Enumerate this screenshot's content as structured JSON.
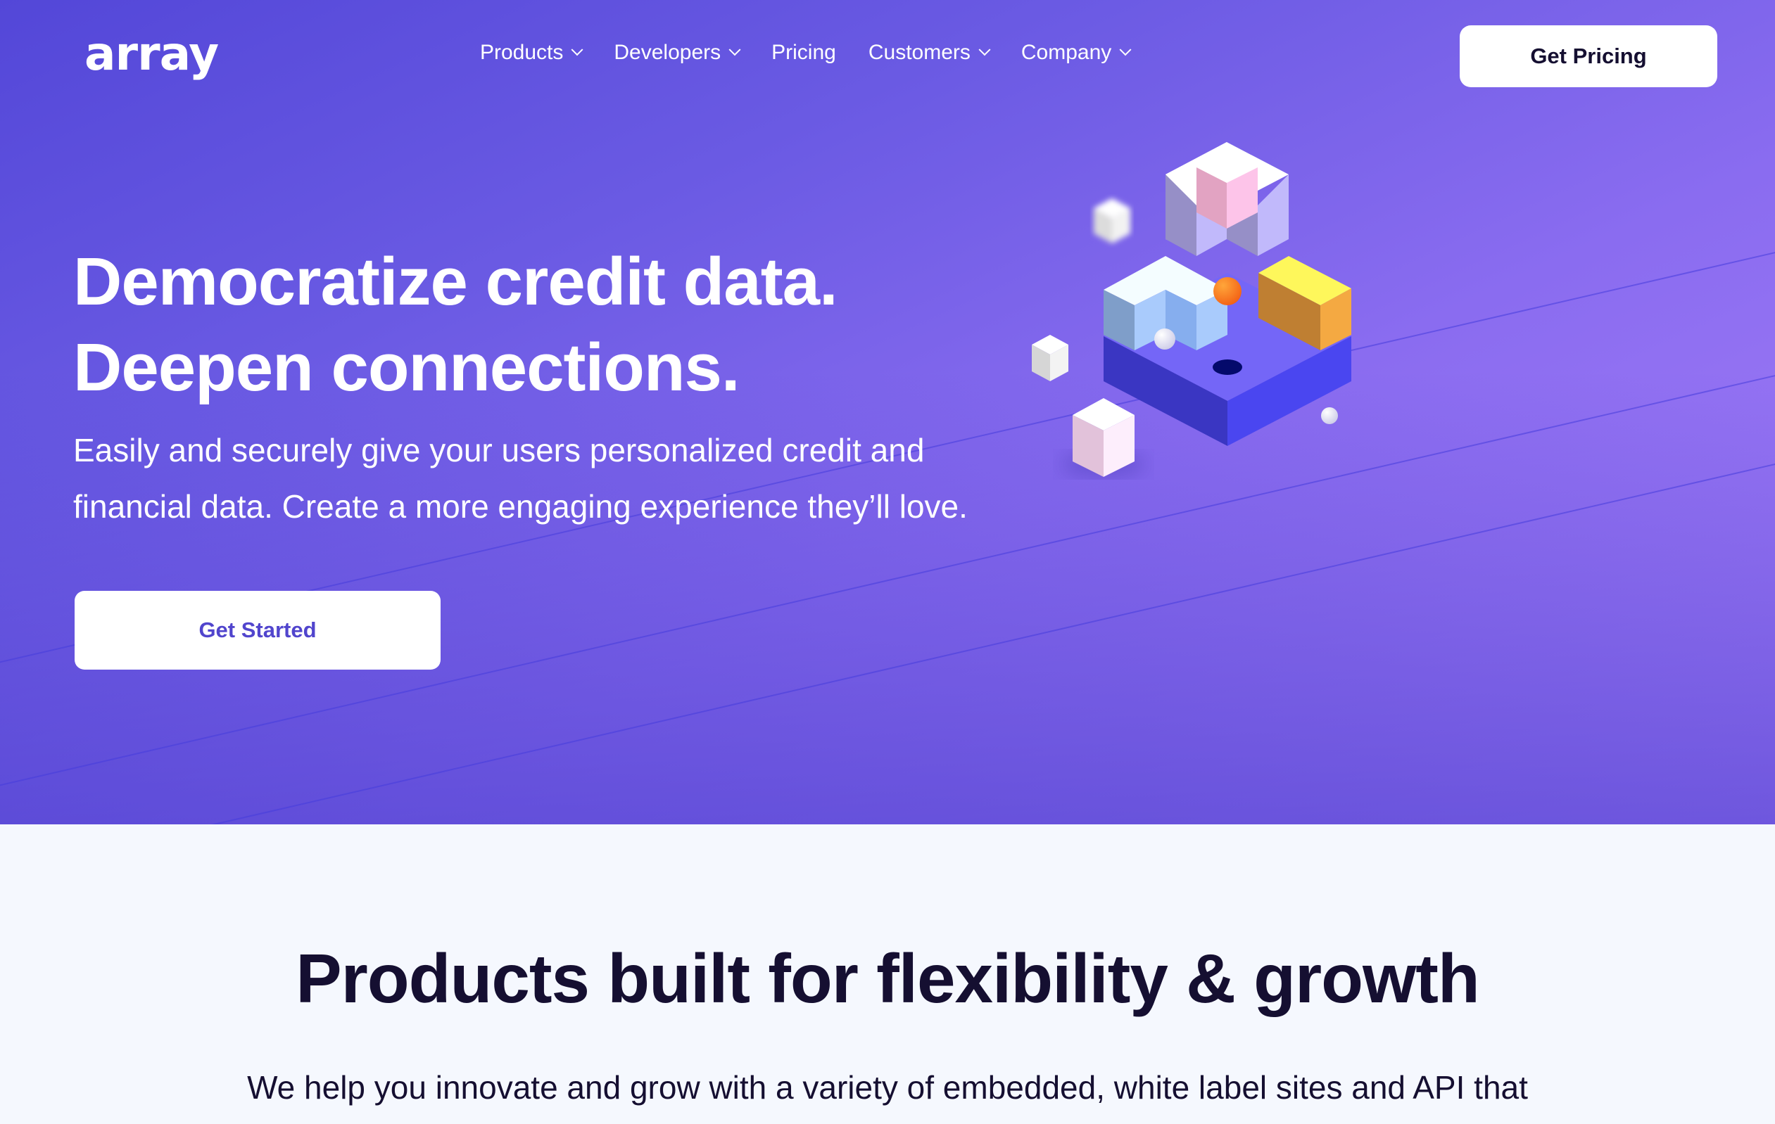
{
  "brand": {
    "logo_text": "array"
  },
  "nav": {
    "items": [
      {
        "label": "Products",
        "has_dropdown": true
      },
      {
        "label": "Developers",
        "has_dropdown": true
      },
      {
        "label": "Pricing",
        "has_dropdown": false
      },
      {
        "label": "Customers",
        "has_dropdown": true
      },
      {
        "label": "Company",
        "has_dropdown": true
      }
    ],
    "cta_label": "Get Pricing"
  },
  "hero": {
    "title_line1": "Democratize credit data.",
    "title_line2": "Deepen connections.",
    "subtitle_line1": "Easily and securely give your users personalized credit and",
    "subtitle_line2": "financial data. Create a more engaging experience they’ll love.",
    "cta_label": "Get Started",
    "illustration": "isometric-blocks-illustration"
  },
  "products_section": {
    "title": "Products built for flexibility & growth",
    "subtitle_line1": "We help you innovate and grow with a variety of embedded, white label sites and API that"
  },
  "colors": {
    "hero_gradient_start": "#5347d8",
    "hero_gradient_end": "#a67ef8",
    "primary_text_dark": "#150f31",
    "accent": "#5145cd",
    "section_bg": "#f5f8fe"
  }
}
